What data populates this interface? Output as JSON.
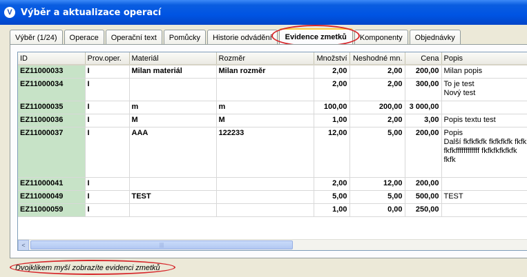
{
  "window": {
    "title": "Výběr a aktualizace operací",
    "icon_letter": "V"
  },
  "tabs": [
    {
      "label": "Výběr (1/24)"
    },
    {
      "label": "Operace"
    },
    {
      "label": "Operační text"
    },
    {
      "label": "Pomůcky"
    },
    {
      "label": "Historie odvádění"
    },
    {
      "label": "Evidence zmetků",
      "active": true
    },
    {
      "label": "Komponenty"
    },
    {
      "label": "Objednávky"
    }
  ],
  "table": {
    "columns": [
      "ID",
      "Prov.oper.",
      "Materiál",
      "Rozměr",
      "Množství",
      "Neshodné mn.",
      "Cena",
      "Popis"
    ],
    "rows": [
      {
        "id": "EZ11000033",
        "prov": "I",
        "material": "Milan materiál",
        "rozmer": "Milan rozměr",
        "mnozstvi": "2,00",
        "neshodne": "2,00",
        "cena": "200,00",
        "popis": "Milan popis"
      },
      {
        "id": "EZ11000034",
        "prov": "I",
        "material": "",
        "rozmer": "",
        "mnozstvi": "2,00",
        "neshodne": "2,00",
        "cena": "300,00",
        "popis": "To je test\nNový test"
      },
      {
        "id": "EZ11000035",
        "prov": "I",
        "material": "m",
        "rozmer": "m",
        "mnozstvi": "100,00",
        "neshodne": "200,00",
        "cena": "3 000,00",
        "popis": ""
      },
      {
        "id": "EZ11000036",
        "prov": "I",
        "material": "M",
        "rozmer": "M",
        "mnozstvi": "1,00",
        "neshodne": "2,00",
        "cena": "3,00",
        "popis": "Popis textu test"
      },
      {
        "id": "EZ11000037",
        "prov": "I",
        "material": "AAA",
        "rozmer": "122233",
        "mnozstvi": "12,00",
        "neshodne": "5,00",
        "cena": "200,00",
        "popis": "Popis\nDalší fkfkfkfk fkfkfkfk fkfkk\nfkfkffffffffffff fkfkfkfkfkfk\nfkfk"
      },
      {
        "id": "EZ11000041",
        "prov": "I",
        "material": "",
        "rozmer": "",
        "mnozstvi": "2,00",
        "neshodne": "12,00",
        "cena": "200,00",
        "popis": ""
      },
      {
        "id": "EZ11000049",
        "prov": "I",
        "material": "TEST",
        "rozmer": "",
        "mnozstvi": "5,00",
        "neshodne": "5,00",
        "cena": "500,00",
        "popis": "TEST"
      },
      {
        "id": "EZ11000059",
        "prov": "I",
        "material": "",
        "rozmer": "",
        "mnozstvi": "1,00",
        "neshodne": "0,00",
        "cena": "250,00",
        "popis": ""
      }
    ]
  },
  "scrollbar": {
    "left_arrow": "<",
    "grip": "|||"
  },
  "status": {
    "text": "Dvojklikem myší zobrazíte evidenci zmetků"
  },
  "colors": {
    "title_bar": "#0054e3",
    "id_cell": "#c7e3c7",
    "highlight_ellipse": "#d6262a",
    "active_tab_accent": "#ffc83c"
  }
}
